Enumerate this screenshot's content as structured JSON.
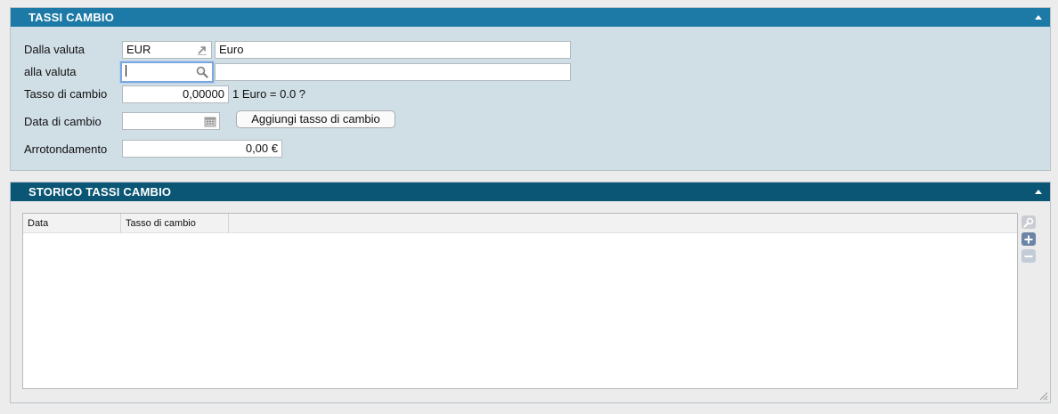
{
  "tassi_cambio": {
    "title": "TASSI CAMBIO",
    "dalla_valuta_label": "Dalla valuta",
    "dalla_valuta_code": "EUR",
    "dalla_valuta_name": "Euro",
    "alla_valuta_label": "alla valuta",
    "alla_valuta_code": "",
    "alla_valuta_name": "",
    "tasso_label": "Tasso di cambio",
    "tasso_value": "0,00000",
    "tasso_hint": "1 Euro = 0.0 ?",
    "data_label": "Data di cambio",
    "data_value": "",
    "add_button": "Aggiungi tasso di cambio",
    "arrotondamento_label": "Arrotondamento",
    "arrotondamento_value": "0,00 €"
  },
  "storico": {
    "title": "STORICO TASSI CAMBIO",
    "columns": [
      "Data",
      "Tasso di cambio"
    ],
    "rows": []
  },
  "icons": {
    "open_link": "open-link-icon",
    "search": "search-icon",
    "calendar": "calendar-icon",
    "collapse": "collapse-up-icon",
    "search_tool": "search-tool-icon",
    "add": "plus-icon",
    "remove": "minus-icon",
    "resize": "resize-grip-icon"
  },
  "colors": {
    "header_primary": "#1d7aa6",
    "header_secondary": "#0b5674",
    "panel_bg": "#d0dee6",
    "focus_ring": "#7aa7e0"
  }
}
